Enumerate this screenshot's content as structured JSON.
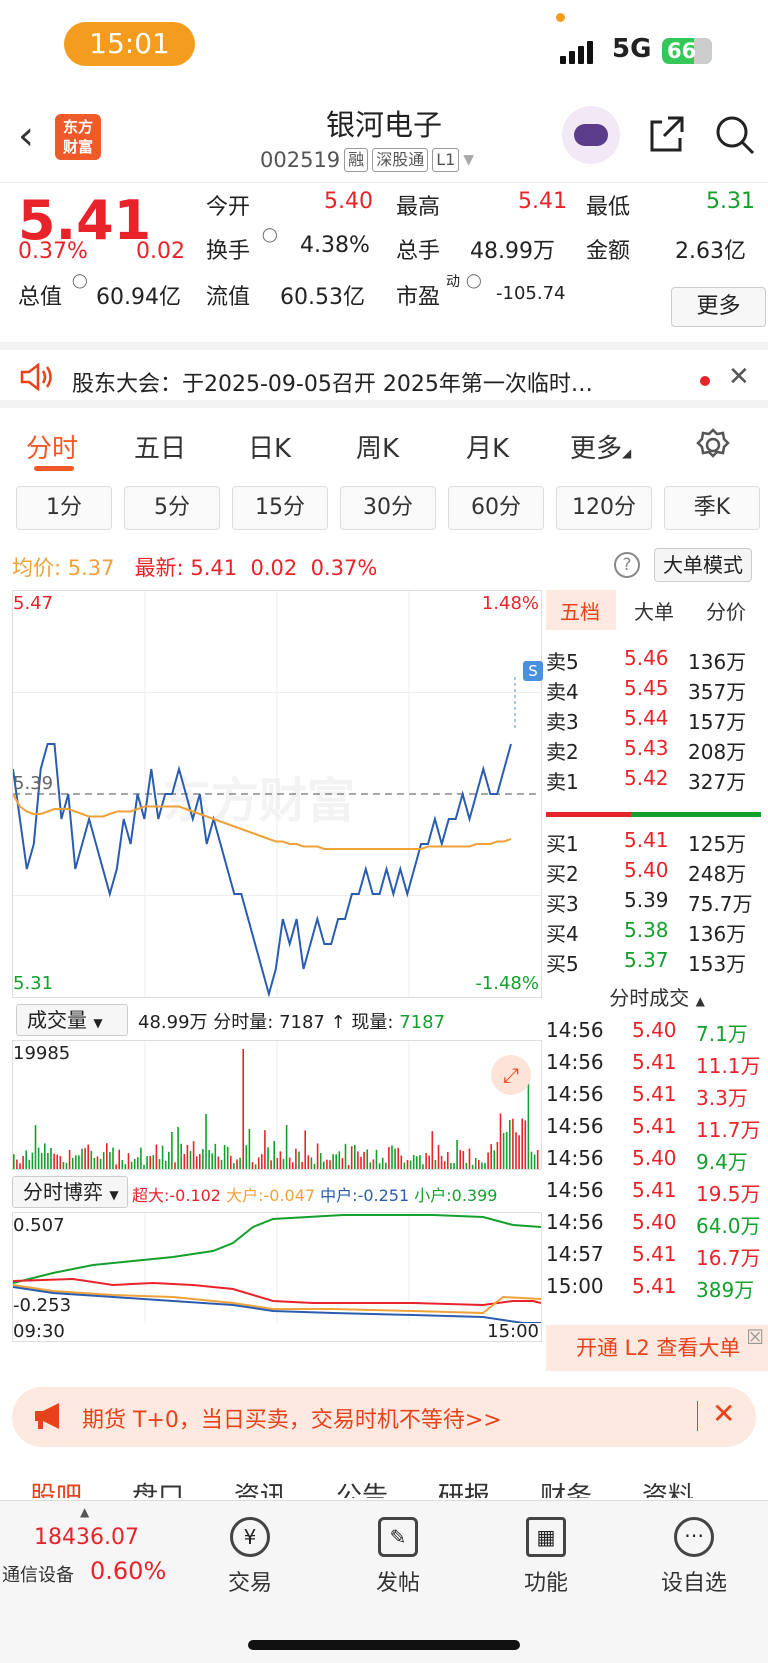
{
  "status_bar": {
    "time": "15:01",
    "network": "5G",
    "battery": "66"
  },
  "header": {
    "logo_line1": "东方",
    "logo_line2": "财富",
    "stock_name": "银河电子",
    "stock_code": "002519",
    "tags": [
      "融",
      "深股通",
      "L1"
    ]
  },
  "quote": {
    "price": "5.41",
    "change_pct": "0.37%",
    "change": "0.02",
    "open_label": "今开",
    "open": "5.40",
    "high_label": "最高",
    "high": "5.41",
    "low_label": "最低",
    "low": "5.31",
    "turnover_label": "换手",
    "turnover": "4.38%",
    "volume_label": "总手",
    "volume": "48.99万",
    "amount_label": "金额",
    "amount": "2.63亿",
    "mcap_label": "总值",
    "mcap": "60.94亿",
    "float_label": "流值",
    "float": "60.53亿",
    "pe_label": "市盈",
    "pe_sup": "动",
    "pe": "-105.74",
    "more": "更多"
  },
  "notice": {
    "text": "股东大会：于2025-09-05召开 2025年第一次临时…"
  },
  "tabs": [
    "分时",
    "五日",
    "日K",
    "周K",
    "月K",
    "更多"
  ],
  "subtabs": [
    "1分",
    "5分",
    "15分",
    "30分",
    "60分",
    "120分",
    "季K"
  ],
  "avg_bar": {
    "avg_label": "均价:",
    "avg": "5.37",
    "latest_label": "最新:",
    "latest": "5.41",
    "chg": "0.02",
    "pct": "0.37%",
    "help": "?",
    "big_mode": "大单模式"
  },
  "chart": {
    "y_top": "5.47",
    "y_bottom": "5.31",
    "y_ref": "5.39",
    "pct_top": "1.48%",
    "pct_bottom": "-1.48%",
    "s_marker": "S",
    "watermark": "东方财富",
    "volume_selector": "成交量",
    "volume_total": "48.99万",
    "vol_detail_label": "分时量:",
    "vol_detail": "7187",
    "now_label": "现量:",
    "now_vol": "7187",
    "vol_max": "19985",
    "game_selector": "分时博弈",
    "game_legend": [
      {
        "label": "超大:",
        "value": "-0.102",
        "color": "#e8242a"
      },
      {
        "label": "大户:",
        "value": "-0.047",
        "color": "#f0a23a"
      },
      {
        "label": "中户:",
        "value": "-0.251",
        "color": "#2a5db0"
      },
      {
        "label": "小户:",
        "value": "0.399",
        "color": "#14a02c"
      }
    ],
    "game_top": "0.507",
    "game_bottom": "-0.253",
    "time_start": "09:30",
    "time_end": "15:00"
  },
  "chart_data": {
    "type": "line",
    "title": "",
    "xlabel": "",
    "ylabel": "",
    "ylim": [
      5.31,
      5.47
    ],
    "ref_price": 5.39,
    "x": [
      "09:30",
      "15:00"
    ],
    "series": [
      {
        "name": "",
        "color": "#2a5db0",
        "values": [
          5.4,
          5.38,
          5.36,
          5.37,
          5.4,
          5.41,
          5.41,
          5.38,
          5.39,
          5.36,
          5.37,
          5.38,
          5.37,
          5.36,
          5.35,
          5.36,
          5.38,
          5.37,
          5.39,
          5.38,
          5.4,
          5.38,
          5.39,
          5.39,
          5.4,
          5.39,
          5.38,
          5.39,
          5.37,
          5.38,
          5.37,
          5.36,
          5.35,
          5.35,
          5.34,
          5.33,
          5.32,
          5.31,
          5.32,
          5.34,
          5.33,
          5.34,
          5.32,
          5.33,
          5.34,
          5.33,
          5.33,
          5.34,
          5.34,
          5.35,
          5.35,
          5.36,
          5.35,
          5.35,
          5.36,
          5.35,
          5.36,
          5.35,
          5.36,
          5.37,
          5.37,
          5.38,
          5.37,
          5.38,
          5.38,
          5.39,
          5.38,
          5.39,
          5.4,
          5.39,
          5.39,
          5.4,
          5.41
        ]
      },
      {
        "name": "",
        "color": "#f0a23a",
        "values": [
          5.39,
          5.385,
          5.383,
          5.382,
          5.382,
          5.383,
          5.384,
          5.384,
          5.384,
          5.383,
          5.382,
          5.381,
          5.381,
          5.381,
          5.382,
          5.383,
          5.383,
          5.383,
          5.384,
          5.385,
          5.385,
          5.385,
          5.385,
          5.385,
          5.385,
          5.384,
          5.383,
          5.382,
          5.381,
          5.38,
          5.379,
          5.378,
          5.377,
          5.376,
          5.375,
          5.374,
          5.373,
          5.372,
          5.371,
          5.371,
          5.37,
          5.37,
          5.369,
          5.369,
          5.369,
          5.368,
          5.368,
          5.368,
          5.368,
          5.368,
          5.368,
          5.368,
          5.368,
          5.368,
          5.368,
          5.368,
          5.368,
          5.368,
          5.368,
          5.368,
          5.369,
          5.369,
          5.369,
          5.369,
          5.369,
          5.369,
          5.369,
          5.37,
          5.37,
          5.37,
          5.371,
          5.371,
          5.372
        ]
      }
    ]
  },
  "order_book": {
    "tabs": [
      "五档",
      "大单",
      "分价"
    ],
    "asks": [
      {
        "label": "卖5",
        "price": "5.46",
        "vol": "136万"
      },
      {
        "label": "卖4",
        "price": "5.45",
        "vol": "357万"
      },
      {
        "label": "卖3",
        "price": "5.44",
        "vol": "157万"
      },
      {
        "label": "卖2",
        "price": "5.43",
        "vol": "208万"
      },
      {
        "label": "卖1",
        "price": "5.42",
        "vol": "327万"
      }
    ],
    "bids": [
      {
        "label": "买1",
        "price": "5.41",
        "vol": "125万",
        "color": "#e8242a"
      },
      {
        "label": "买2",
        "price": "5.40",
        "vol": "248万",
        "color": "#e8242a"
      },
      {
        "label": "买3",
        "price": "5.39",
        "vol": "75.7万",
        "color": "#222"
      },
      {
        "label": "买4",
        "price": "5.38",
        "vol": "136万",
        "color": "#14a02c"
      },
      {
        "label": "买5",
        "price": "5.37",
        "vol": "153万",
        "color": "#14a02c"
      }
    ]
  },
  "ticks": {
    "header": "分时成交",
    "rows": [
      {
        "time": "14:56",
        "price": "5.40",
        "vol": "7.1万",
        "pc": "#e8242a",
        "vc": "#14a02c"
      },
      {
        "time": "14:56",
        "price": "5.41",
        "vol": "11.1万",
        "pc": "#e8242a",
        "vc": "#e8242a"
      },
      {
        "time": "14:56",
        "price": "5.41",
        "vol": "3.3万",
        "pc": "#e8242a",
        "vc": "#e8242a"
      },
      {
        "time": "14:56",
        "price": "5.41",
        "vol": "11.7万",
        "pc": "#e8242a",
        "vc": "#e8242a"
      },
      {
        "time": "14:56",
        "price": "5.40",
        "vol": "9.4万",
        "pc": "#e8242a",
        "vc": "#14a02c"
      },
      {
        "time": "14:56",
        "price": "5.41",
        "vol": "19.5万",
        "pc": "#e8242a",
        "vc": "#e8242a"
      },
      {
        "time": "14:56",
        "price": "5.40",
        "vol": "64.0万",
        "pc": "#e8242a",
        "vc": "#14a02c"
      },
      {
        "time": "14:57",
        "price": "5.41",
        "vol": "16.7万",
        "pc": "#e8242a",
        "vc": "#e8242a"
      },
      {
        "time": "15:00",
        "price": "5.41",
        "vol": "389万",
        "pc": "#e8242a",
        "vc": "#14a02c"
      }
    ],
    "l2": "开通 L2 查看大单"
  },
  "ad": {
    "text": "期货 T+0，当日买卖，交易时机不等待>>"
  },
  "section_tabs": [
    "股吧",
    "盘口",
    "资讯",
    "公告",
    "研报",
    "财务",
    "资料"
  ],
  "bottom": {
    "index_value": "18436.07",
    "index_name": "通信设备",
    "index_pct": "0.60%",
    "items": [
      "交易",
      "发帖",
      "功能",
      "设自选"
    ]
  }
}
